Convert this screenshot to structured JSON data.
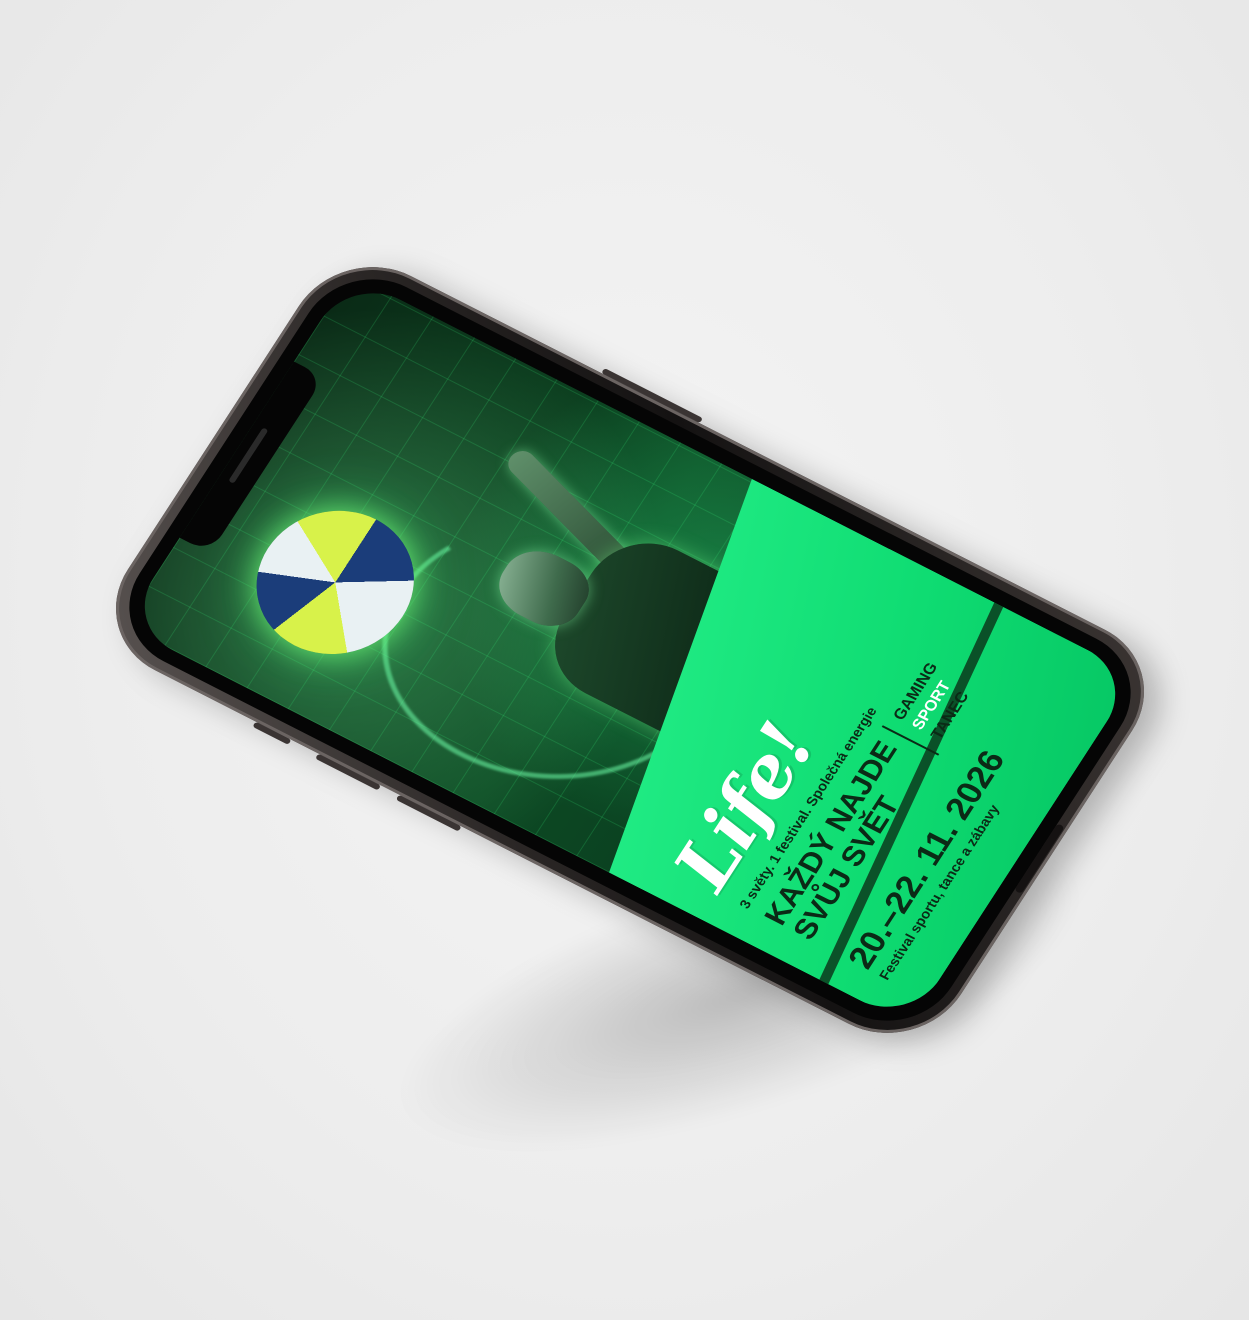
{
  "screen": {
    "logo": "Life!",
    "tagline": "3 světy. 1 festival. Společná energie",
    "headline_line1": "KAŽDÝ NAJDE",
    "headline_line2": "SVŮJ SVĚT",
    "categories": [
      "GAMING",
      "SPORT",
      "TANEC"
    ],
    "date": "20.–22. 11. 2026",
    "subtitle": "Festival sportu, tance a zábavy"
  },
  "colors": {
    "accent_green": "#12e07a",
    "dark_green": "#0b2a16",
    "phone_frame": "#2a2625",
    "background": "#eeeeee"
  }
}
